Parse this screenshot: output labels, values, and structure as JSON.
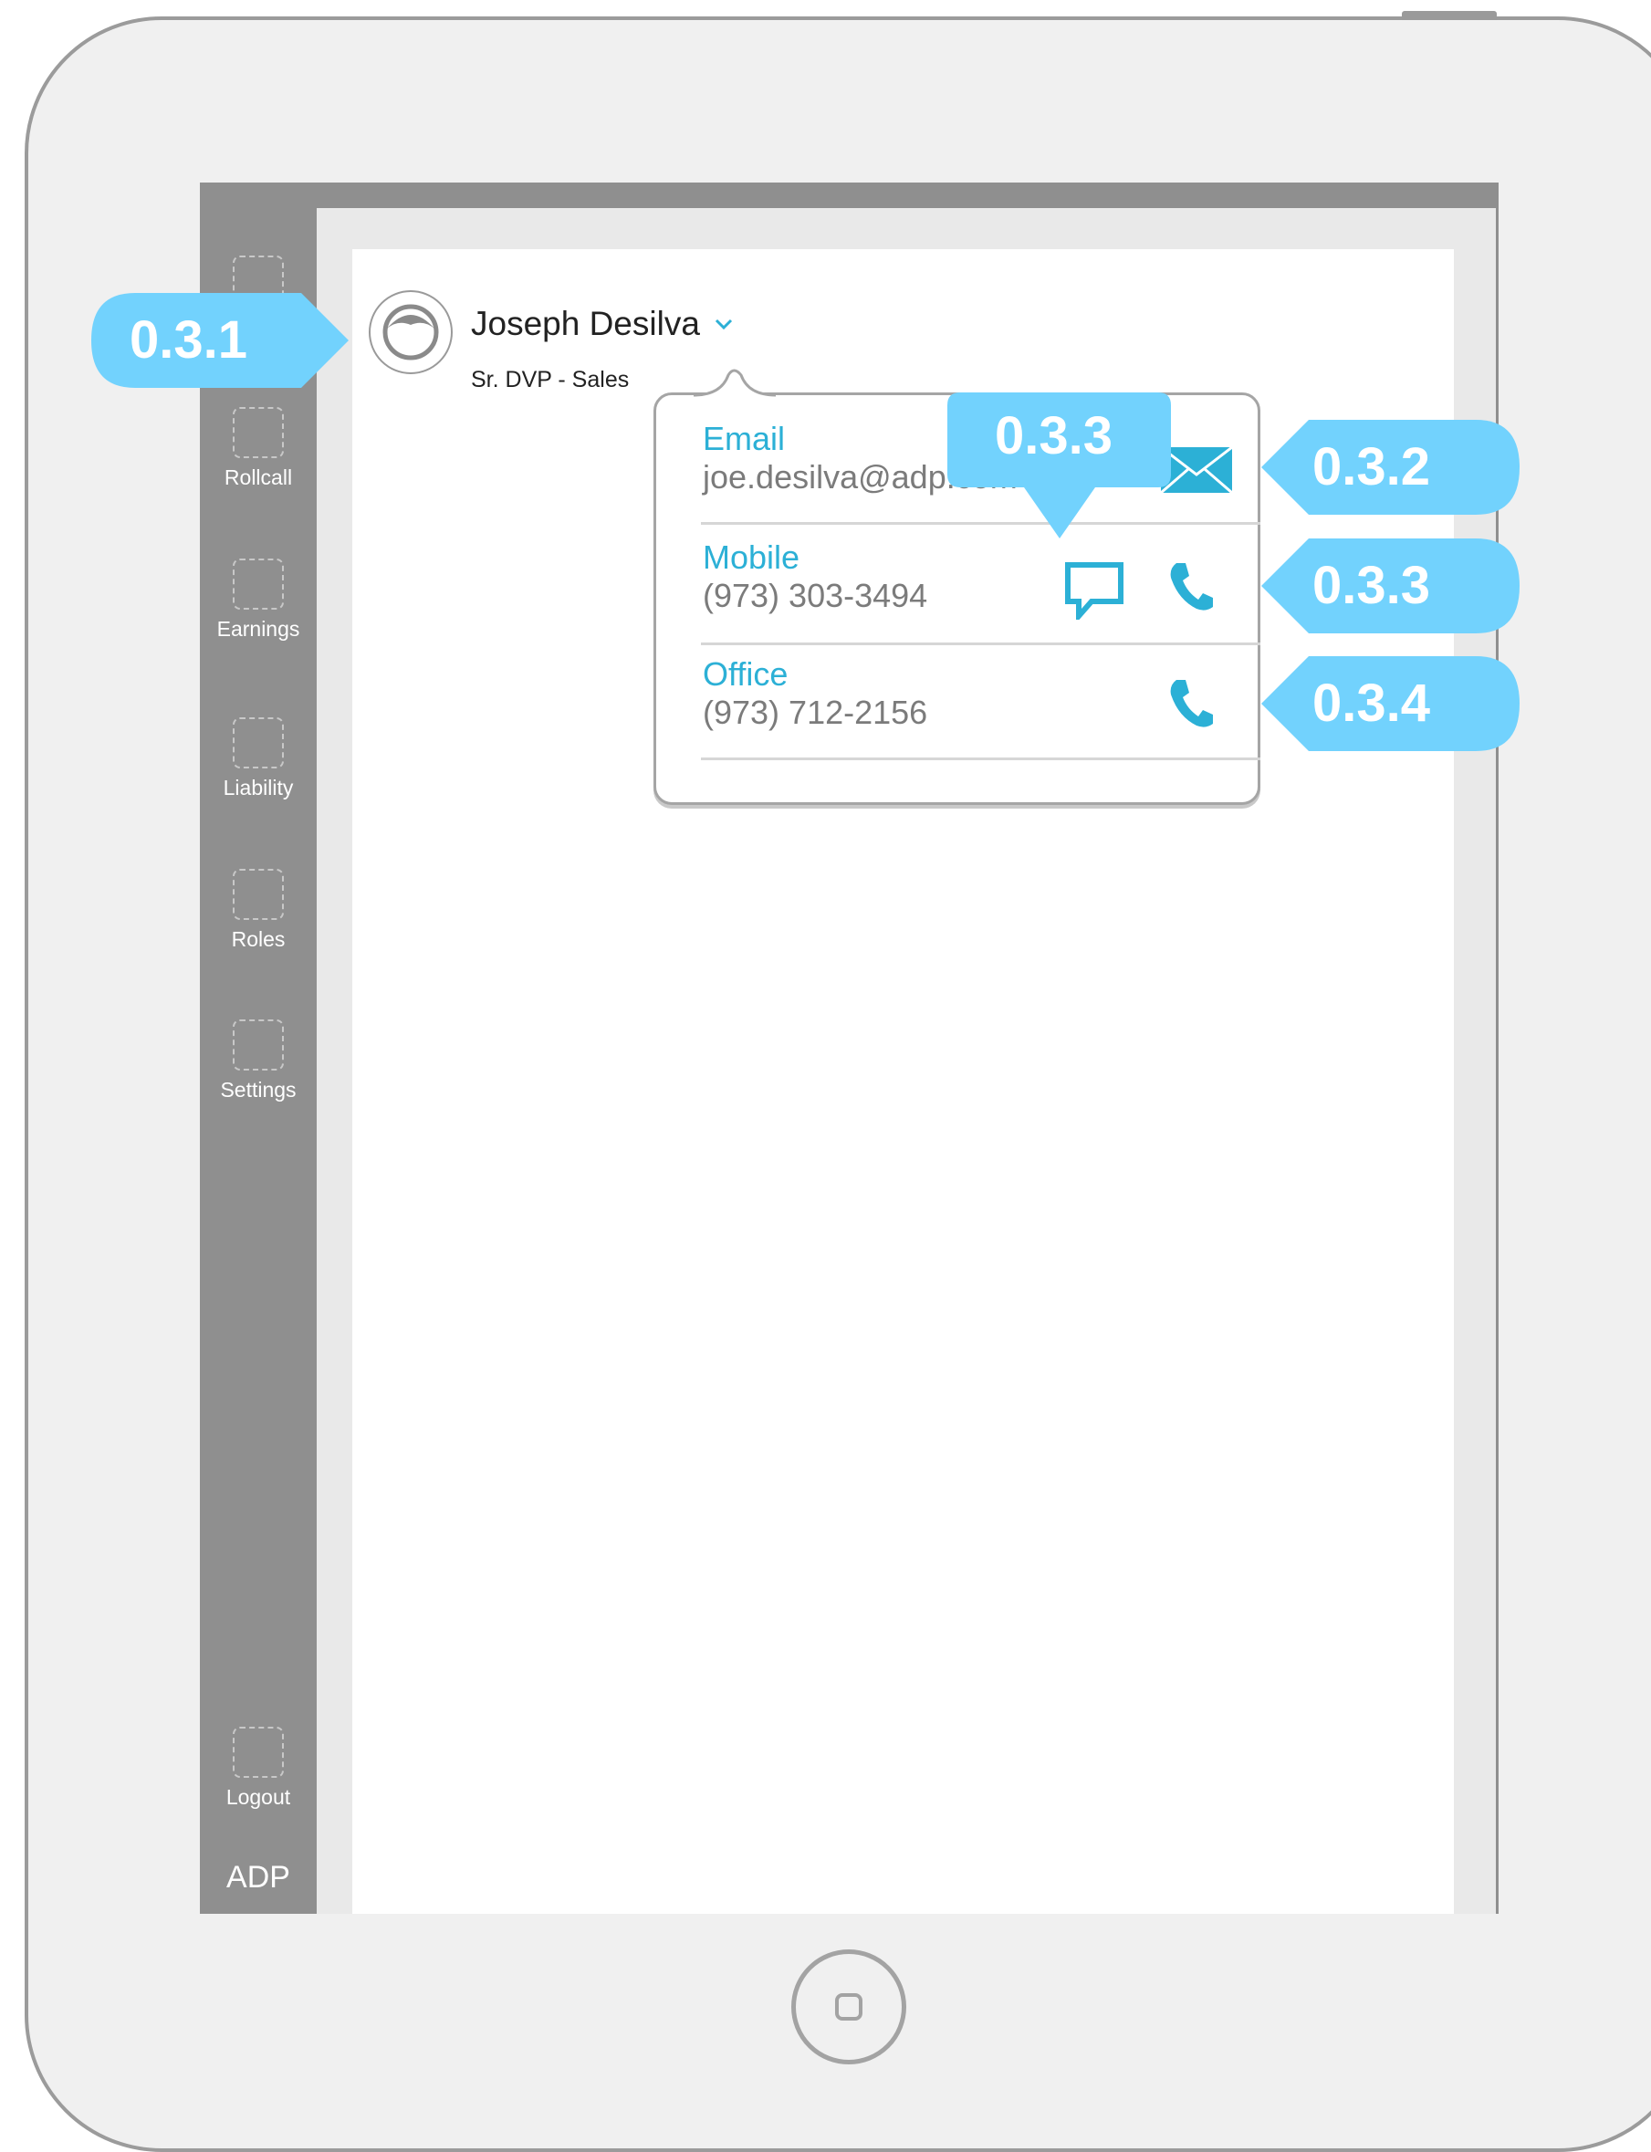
{
  "sidebar": {
    "items": [
      {
        "label": ""
      },
      {
        "label": "Rollcall"
      },
      {
        "label": "Earnings"
      },
      {
        "label": "Liability"
      },
      {
        "label": "Roles"
      },
      {
        "label": "Settings"
      },
      {
        "label": "Logout"
      }
    ],
    "brand": "ADP"
  },
  "profile": {
    "name": "Joseph Desilva",
    "title": "Sr. DVP  - Sales"
  },
  "contact": {
    "email_label": "Email",
    "email_value": "joe.desilva@adp.com",
    "mobile_label": "Mobile",
    "mobile_value": "(973) 303-3494",
    "office_label": "Office",
    "office_value": "(973) 712-2156"
  },
  "callouts": {
    "profile": "0.3.1",
    "email": "0.3.2",
    "message": "0.3.3",
    "mobile": "0.3.3",
    "office": "0.3.4"
  },
  "colors": {
    "accent": "#2cb0d6",
    "callout": "#72d2fd",
    "sidebar": "#8f8f8f"
  },
  "icons": [
    "user-avatar-icon",
    "chevron-down-icon",
    "envelope-icon",
    "chat-bubble-icon",
    "phone-icon",
    "home-button-icon"
  ]
}
